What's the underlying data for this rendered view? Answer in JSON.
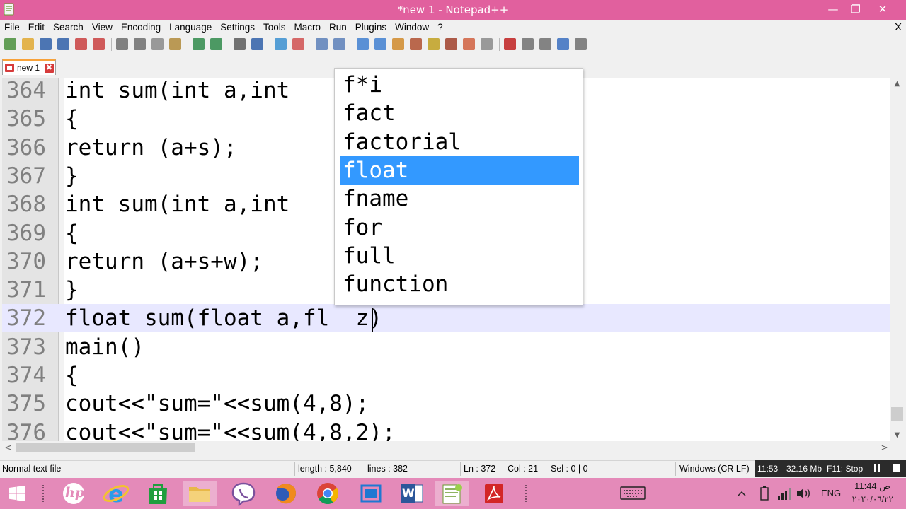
{
  "window": {
    "title": "*new 1 - Notepad++",
    "minimize_glyph": "—",
    "maximize_glyph": "❐",
    "close_glyph": "✕"
  },
  "menu": {
    "items": [
      "File",
      "Edit",
      "Search",
      "View",
      "Encoding",
      "Language",
      "Settings",
      "Tools",
      "Macro",
      "Run",
      "Plugins",
      "Window",
      "?"
    ],
    "close_label": "X"
  },
  "toolbar": {
    "icons": [
      "new-file-icon",
      "open-file-icon",
      "save-icon",
      "save-all-icon",
      "close-icon",
      "close-all-icon",
      "print-icon",
      "cut-icon",
      "copy-icon",
      "paste-icon",
      "undo-icon",
      "redo-icon",
      "find-icon",
      "replace-icon",
      "zoom-in-icon",
      "zoom-out-icon",
      "sync-vertical-icon",
      "sync-horizontal-icon",
      "word-wrap-icon",
      "show-all-characters-icon",
      "indent-guide-icon",
      "udl-icon",
      "doc-map-icon",
      "function-list-icon",
      "folder-workspace-icon",
      "monitoring-icon",
      "record-macro-icon",
      "stop-record-icon",
      "play-macro-icon",
      "run-macro-multiple-icon",
      "save-macro-icon"
    ]
  },
  "tabs": [
    {
      "label": "new 1",
      "close_glyph": "✖"
    }
  ],
  "editor": {
    "lines": [
      {
        "number": "364",
        "code": "int sum(int a,int"
      },
      {
        "number": "365",
        "code": "{"
      },
      {
        "number": "366",
        "code": "return (a+s);"
      },
      {
        "number": "367",
        "code": "}"
      },
      {
        "number": "368",
        "code": "int sum(int a,int"
      },
      {
        "number": "369",
        "code": "{"
      },
      {
        "number": "370",
        "code": "return (a+s+w);"
      },
      {
        "number": "371",
        "code": "}"
      },
      {
        "number": "372",
        "code": "float sum(float a,fl  z)"
      },
      {
        "number": "373",
        "code": "main()"
      },
      {
        "number": "374",
        "code": "{"
      },
      {
        "number": "375",
        "code": "cout<<\"sum=\"<<sum(4,8);"
      },
      {
        "number": "376",
        "code": "cout<<\"sum=\"<<sum(4,8,2);"
      }
    ],
    "current_line": "372"
  },
  "autocomplete": {
    "items": [
      "f*i",
      "fact",
      "factorial",
      "float",
      "fname",
      "for",
      "full",
      "function"
    ],
    "selected": "float"
  },
  "scrollbars": {
    "up_glyph": "▲",
    "down_glyph": "▼",
    "left_glyph": "<",
    "right_glyph": ">"
  },
  "statusbar": {
    "file_type": "Normal text file",
    "length": "length : 5,840",
    "lines": "lines : 382",
    "ln": "Ln : 372",
    "col": "Col : 21",
    "sel": "Sel : 0 | 0",
    "eol": "Windows (CR LF)"
  },
  "overlay": {
    "time": "11:53",
    "memory": "32.16 Mb",
    "hotkey": "F11: Stop"
  },
  "taskbar": {
    "apps": [
      "windows-start-icon",
      "hp-icon",
      "internet-explorer-icon",
      "store-icon",
      "file-explorer-icon",
      "viber-icon",
      "firefox-icon",
      "chrome-icon",
      "snipping-icon",
      "word-icon",
      "notepad-plus-plus-icon",
      "acrobat-icon"
    ],
    "active_app": "notepad-plus-plus-icon",
    "hp_label": "hp",
    "word_label": "W",
    "language": "ENG",
    "clock_time": "11:44 ص",
    "clock_date": "٢٠٢٠/٠٦/٢٢"
  },
  "colors": {
    "titlebar": "#e1609e",
    "taskbar": "#e48ab9",
    "selection": "#3399ff",
    "current_line": "#e8e8ff"
  }
}
